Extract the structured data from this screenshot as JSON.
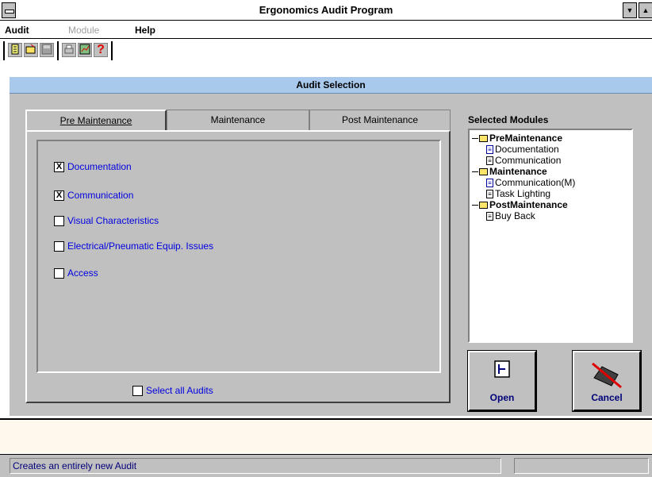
{
  "window": {
    "title": "Ergonomics Audit Program"
  },
  "menu": {
    "items": [
      "Audit",
      "Module",
      "Help"
    ]
  },
  "toolbar": {
    "buttons": [
      "new-icon",
      "open-icon",
      "save-icon",
      "print-icon",
      "chart-icon",
      "help-icon"
    ],
    "help_glyph": "?"
  },
  "section": {
    "title": "Audit Selection"
  },
  "tabs": [
    "Pre Maintenance",
    "Maintenance",
    "Post Maintenance"
  ],
  "active_tab": 0,
  "audits": [
    {
      "label": "Documentation",
      "checked": true
    },
    {
      "label": "Communication",
      "checked": true
    },
    {
      "label": "Visual Characteristics",
      "checked": false
    },
    {
      "label": "Electrical/Pneumatic Equip. Issues",
      "checked": false
    },
    {
      "label": "Access",
      "checked": false
    }
  ],
  "select_all": {
    "label": "Select all Audits",
    "checked": false
  },
  "modules": {
    "label": "Selected Modules",
    "tree": [
      {
        "label": "PreMaintenance",
        "level": 0,
        "type": "folder"
      },
      {
        "label": "Documentation",
        "level": 1,
        "type": "doc"
      },
      {
        "label": "Communication",
        "level": 1,
        "type": "doc"
      },
      {
        "label": "Maintenance",
        "level": 0,
        "type": "folder"
      },
      {
        "label": "Communication(M)",
        "level": 1,
        "type": "doc"
      },
      {
        "label": "Task Lighting",
        "level": 1,
        "type": "doc"
      },
      {
        "label": "PostMaintenance",
        "level": 0,
        "type": "folder"
      },
      {
        "label": "Buy Back",
        "level": 1,
        "type": "doc"
      }
    ]
  },
  "buttons": {
    "open": "Open",
    "cancel": "Cancel"
  },
  "status": {
    "message": "Creates an entirely new Audit",
    "secondary": ""
  },
  "colors": {
    "header": "#a8c8ec",
    "panel": "#c0c0c0",
    "link": "#0000e0"
  }
}
